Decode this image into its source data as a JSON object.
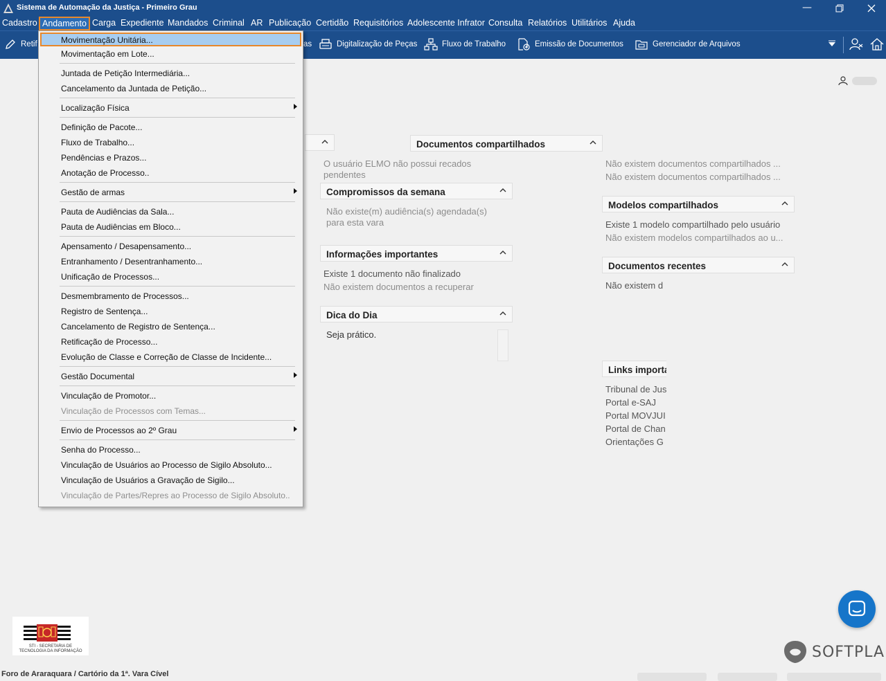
{
  "window": {
    "title": "Sistema de Automação da Justiça - Primeiro Grau"
  },
  "menubar": {
    "items": [
      "Cadastro",
      "Andamento",
      "Carga",
      "Expediente",
      "Mandados",
      "Criminal",
      "AR",
      "Publicação",
      "Certidão",
      "Requisitórios",
      "Adolescente Infrator",
      "Consulta",
      "Relatórios",
      "Utilitários",
      "Ajuda"
    ],
    "active": "Andamento"
  },
  "toolbar": {
    "partial_left": "Retif",
    "partial_mid": "as",
    "digitalizacao": "Digitalização de Peças",
    "fluxo": "Fluxo de Trabalho",
    "emissao": "Emissão de Documentos",
    "gerenciador": "Gerenciador de Arquivos"
  },
  "dropdown": {
    "items": [
      {
        "label": "Movimentação Unitária...",
        "highlighted": true
      },
      {
        "label": "Movimentação em Lote..."
      },
      {
        "label": "Juntada de Petição Intermediária..."
      },
      {
        "label": "Cancelamento da Juntada de Petição..."
      },
      {
        "label": "Localização Física",
        "submenu": true
      },
      {
        "label": "Definição de Pacote..."
      },
      {
        "label": "Fluxo de Trabalho..."
      },
      {
        "label": "Pendências e Prazos..."
      },
      {
        "label": "Anotação de Processo.."
      },
      {
        "label": "Gestão de armas",
        "submenu": true
      },
      {
        "label": "Pauta de Audiências da Sala..."
      },
      {
        "label": "Pauta de Audiências em Bloco..."
      },
      {
        "label": "Apensamento / Desapensamento..."
      },
      {
        "label": "Entranhamento / Desentranhamento..."
      },
      {
        "label": "Unificação de Processos..."
      },
      {
        "label": "Desmembramento de Processos..."
      },
      {
        "label": "Registro de Sentença..."
      },
      {
        "label": "Cancelamento de Registro de Sentença..."
      },
      {
        "label": "Retificação de Processo..."
      },
      {
        "label": "Evolução de Classe e Correção de Classe de Incidente..."
      },
      {
        "label": "Gestão Documental",
        "submenu": true
      },
      {
        "label": "Vinculação de Promotor..."
      },
      {
        "label": "Vinculação de Processos com Temas...",
        "disabled": true
      },
      {
        "label": "Envio de Processos ao 2º Grau",
        "submenu": true
      },
      {
        "label": "Senha do Processo..."
      },
      {
        "label": "Vinculação de Usuários ao Processo de Sigilo Absoluto..."
      },
      {
        "label": "Vinculação de Usuários a Gravação de Sigilo..."
      },
      {
        "label": "Vinculação de Partes/Repres ao Processo de Sigilo Absoluto..",
        "disabled": true
      }
    ]
  },
  "panels": {
    "recados": {
      "line1": "O usuário ELMO não possui recados",
      "line2": "pendentes"
    },
    "compromissos": {
      "title": "Compromissos da semana",
      "line1": "Não existe(m) audiência(s) agendada(s)",
      "line2": "para esta vara"
    },
    "informacoes": {
      "title": "Informações importantes",
      "line1": "Existe 1 documento não finalizado",
      "line2": "Não existem documentos a recuperar"
    },
    "dica": {
      "title": "Dica do Dia",
      "line1": "Seja prático."
    },
    "compartilhados": {
      "title": "Documentos compartilhados",
      "line1": "Não existem documentos compartilhados ...",
      "line2": "Não existem documentos compartilhados ..."
    },
    "modelos": {
      "title": "Modelos compartilhados",
      "line1": "Existe 1 modelo compartilhado pelo usuário",
      "line2": "Não existem modelos compartilhados ao u..."
    },
    "recentes": {
      "title": "Documentos recentes",
      "line1": "Não existem d"
    },
    "links": {
      "title": "Links importa",
      "items": [
        "Tribunal de Jus",
        "Portal e-SAJ",
        "Portal MOVJUI",
        "Portal de Chan",
        "Orientações G"
      ]
    }
  },
  "logo": {
    "line1": "STI - SECRETARIA DE",
    "line2": "TECNOLOGIA DA INFORMAÇÃO"
  },
  "brand": "SOFTPLAN",
  "footer": "Foro de Araraquara / Cartório da 1ª. Vara Cível",
  "colors": {
    "brand_blue": "#1c4e8c",
    "highlight_orange": "#e8882a",
    "menu_highlight": "#a7cdf0",
    "chat_blue": "#1675c9"
  }
}
